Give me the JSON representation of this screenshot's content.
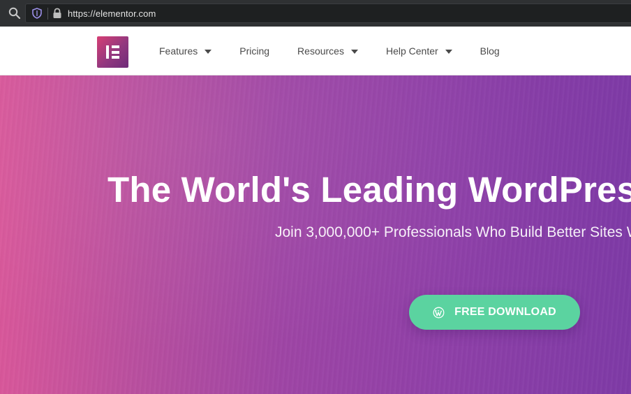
{
  "browser": {
    "url": "https://elementor.com"
  },
  "header": {
    "logo_icon": "elementor-logo",
    "nav": [
      {
        "label": "Features",
        "has_dropdown": true
      },
      {
        "label": "Pricing",
        "has_dropdown": false
      },
      {
        "label": "Resources",
        "has_dropdown": true
      },
      {
        "label": "Help Center",
        "has_dropdown": true
      },
      {
        "label": "Blog",
        "has_dropdown": false
      }
    ]
  },
  "hero": {
    "title": "The World's Leading WordPres",
    "subtitle": "Join 3,000,000+ Professionals Who Build Better Sites W",
    "cta_label": "FREE DOWNLOAD",
    "cta_icon": "wordpress-icon"
  },
  "colors": {
    "browser_chrome": "#2f3133",
    "hero_gradient_start": "#d8579a",
    "hero_gradient_end": "#7e3aa6",
    "cta": "#5bd3a0",
    "nav_text": "#4a4a4a"
  }
}
